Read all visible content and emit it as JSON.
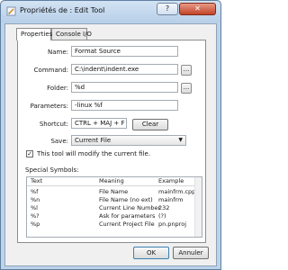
{
  "window": {
    "title": "Propriétés de : Edit Tool",
    "help_label": "?",
    "close_label": "✕"
  },
  "tabs": [
    {
      "label": "Properties"
    },
    {
      "label": "Console I/O"
    }
  ],
  "form": {
    "name": {
      "label": "Name:",
      "value": "Format Source"
    },
    "command": {
      "label": "Command:",
      "value": "C:\\indent\\indent.exe",
      "browse_label": "..."
    },
    "folder": {
      "label": "Folder:",
      "value": "%d",
      "browse_label": "..."
    },
    "parameters": {
      "label": "Parameters:",
      "value": "-linux %f"
    },
    "shortcut": {
      "label": "Shortcut:",
      "value": "CTRL + MAJ + F",
      "clear_label": "Clear"
    },
    "save": {
      "label": "Save:",
      "value": "Current File",
      "arrow": "▼"
    },
    "modify_checkbox": {
      "checked": true,
      "mark": "✓",
      "label": "This tool will modify the current file."
    }
  },
  "special_symbols": {
    "title": "Special Symbols:",
    "columns": [
      "Text",
      "Meaning",
      "Example"
    ],
    "rows": [
      [
        "%f",
        "File Name",
        "mainfrm.cpp"
      ],
      [
        "%n",
        "File Name (no ext)",
        "mainfrm"
      ],
      [
        "%l",
        "Current Line Number",
        "232"
      ],
      [
        "%?",
        "Ask for parameters",
        "(?)"
      ],
      [
        "%p",
        "Current Project File",
        "pn.pnproj"
      ]
    ]
  },
  "buttons": {
    "ok": "OK",
    "cancel": "Annuler"
  }
}
